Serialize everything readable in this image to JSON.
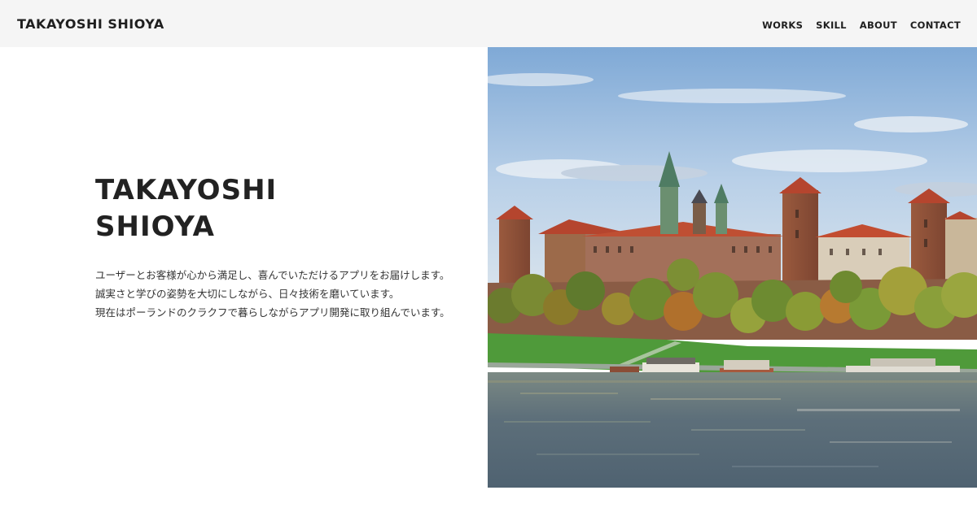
{
  "header": {
    "logo": "TAKAYOSHI SHIOYA",
    "nav": [
      {
        "label": "WORKS"
      },
      {
        "label": "SKILL"
      },
      {
        "label": "ABOUT"
      },
      {
        "label": "CONTACT"
      }
    ]
  },
  "hero": {
    "title_line1": "TAKAYOSHI",
    "title_line2": "SHIOYA",
    "description": [
      "ユーザーとお客様が心から満足し、喜んでいただけるアプリをお届けします。",
      "誠実さと学びの姿勢を大切にしながら、日々技術を磨いています。",
      "現在はポーランドのクラクフで暮らしながらアプリ開発に取り組んでいます。"
    ]
  },
  "colors": {
    "header_bg": "#f5f5f5",
    "text": "#222222",
    "sky": "#8fb6df",
    "river": "#5b6f7d",
    "lawn": "#4f9a3a",
    "roof": "#b5452e"
  }
}
